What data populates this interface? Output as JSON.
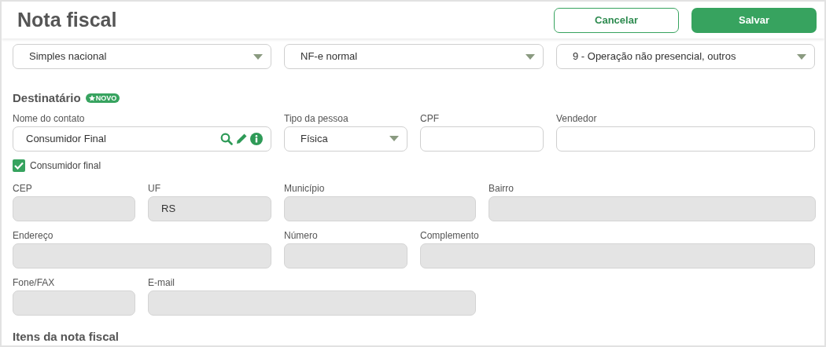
{
  "header": {
    "title": "Nota fiscal",
    "buttons": [
      {
        "label": "Cancelar",
        "kind": "secondary"
      },
      {
        "label": "Salvar",
        "kind": "primary"
      }
    ]
  },
  "top_selects": [
    {
      "value": "Simples nacional",
      "kind": "select"
    },
    {
      "value": "NF-e normal",
      "kind": "select"
    },
    {
      "value": "9 - Operação não presencial, outros",
      "kind": "select"
    }
  ],
  "destinatario": {
    "title": "Destinatário",
    "badge": "NOVO",
    "contact_row": [
      {
        "label": "Nome do contato",
        "value": "Consumidor Final",
        "kind": "lookup",
        "disabled": false
      },
      {
        "label": "Tipo da pessoa",
        "value": "Física",
        "kind": "select",
        "disabled": false
      },
      {
        "label": "CPF",
        "kind": "text",
        "disabled": false
      },
      {
        "label": "Vendedor",
        "kind": "text",
        "disabled": false
      }
    ],
    "consumidor_final": {
      "label": "Consumidor final",
      "checked": true
    },
    "address_rows": [
      [
        {
          "label": "CEP",
          "kind": "text",
          "disabled": true
        },
        {
          "label": "UF",
          "value": "RS",
          "kind": "text",
          "disabled": true
        },
        {
          "label": "Município",
          "kind": "text",
          "disabled": true
        },
        {
          "label": "Bairro",
          "kind": "text",
          "disabled": true
        }
      ],
      [
        {
          "label": "Endereço",
          "kind": "text",
          "disabled": true
        },
        {
          "label": "Número",
          "kind": "text",
          "disabled": true
        },
        {
          "label": "Complemento",
          "kind": "text",
          "disabled": true
        }
      ],
      [
        {
          "label": "Fone/FAX",
          "kind": "text",
          "disabled": true
        },
        {
          "label": "E-mail",
          "kind": "text",
          "disabled": true
        }
      ]
    ]
  },
  "itens": {
    "title": "Itens da nota fiscal"
  }
}
